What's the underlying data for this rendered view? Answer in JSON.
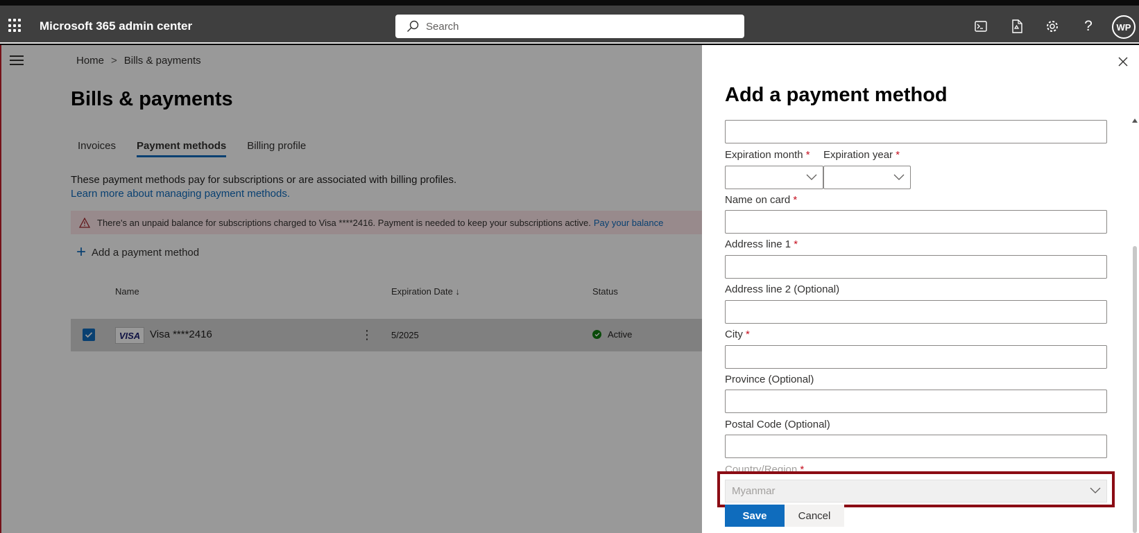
{
  "header": {
    "app_title": "Microsoft 365 admin center",
    "search_placeholder": "Search",
    "avatar_initials": "WP",
    "icons": [
      "waffle-icon",
      "search-icon",
      "terminal-icon",
      "document-icon",
      "gear-icon",
      "help-icon"
    ]
  },
  "breadcrumb": {
    "home": "Home",
    "separator": ">",
    "current": "Bills & payments"
  },
  "page": {
    "title": "Bills & payments",
    "tabs": [
      {
        "label": "Invoices",
        "active": false
      },
      {
        "label": "Payment methods",
        "active": true
      },
      {
        "label": "Billing profile",
        "active": false
      }
    ],
    "description": "These payment methods pay for subscriptions or are associated with billing profiles.",
    "learn_more": "Learn more about managing payment methods.",
    "alert": {
      "text": "There's an unpaid balance for subscriptions charged to Visa ****2416. Payment is needed to keep your subscriptions active.",
      "link": "Pay your balance"
    },
    "add_method_label": "Add a payment method",
    "table": {
      "columns": {
        "name": "Name",
        "expiration": "Expiration Date ↓",
        "status": "Status"
      },
      "rows": [
        {
          "brand": "VISA",
          "name": "Visa ****2416",
          "expiration": "5/2025",
          "status": "Active",
          "selected": true
        }
      ]
    }
  },
  "panel": {
    "title": "Add a payment method",
    "required_mark": "*",
    "fields": {
      "expiration_month": "Expiration month",
      "expiration_year": "Expiration year",
      "name_on_card": "Name on card",
      "address_line_1": "Address line 1",
      "address_line_2": "Address line 2 (Optional)",
      "city": "City",
      "province": "Province (Optional)",
      "postal_code": "Postal Code (Optional)",
      "country_region": "Country/Region"
    },
    "country_value": "Myanmar",
    "save_label": "Save",
    "cancel_label": "Cancel"
  },
  "colors": {
    "accent": "#0f6cbd",
    "topbar": "#3f3f3f",
    "highlight_border": "#8b0c14",
    "alert_bg": "#fde7e9",
    "status_active": "#107c10"
  }
}
